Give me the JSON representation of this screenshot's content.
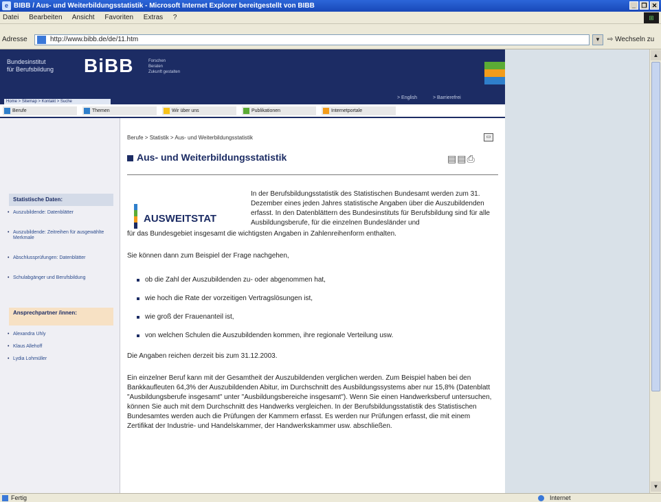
{
  "window": {
    "title": "BIBB / Aus- und Weiterbildungsstatistik - Microsoft Internet Explorer bereitgestellt von BIBB",
    "controls": [
      "_",
      "❐",
      "✕"
    ]
  },
  "menubar": {
    "items": [
      "Datei",
      "Bearbeiten",
      "Ansicht",
      "Favoriten",
      "Extras",
      "?"
    ]
  },
  "address": {
    "label": "Adresse",
    "url": "http://www.bibb.de/de/11.htm",
    "go_label": "Wechseln zu"
  },
  "header": {
    "institute": "Bundesinstitut\nfür Berufsbildung",
    "logo": "BiBB",
    "tagline": "Forschen\nBeraten\nZukunft gestalten",
    "lang_en": "> English",
    "lang_other": "> Barrierefrei",
    "breadcrumb_tab": "Home > Sitemap > Kontakt > Suche",
    "brand_colors": [
      "#5bab35",
      "#f39c1a",
      "#2f7fcb",
      "#1c2c64"
    ]
  },
  "nav": {
    "items": [
      {
        "label": "Berufe",
        "color": "#2f7fcb"
      },
      {
        "label": "Themen",
        "color": "#2f7fcb"
      },
      {
        "label": "Wir über uns",
        "color": "#f7c21a"
      },
      {
        "label": "Publikationen",
        "color": "#5bab35"
      },
      {
        "label": "Internetportale",
        "color": "#f39c1a"
      }
    ]
  },
  "sidebar": {
    "box1_title": "Statistische Daten:",
    "box1_items": [
      "Auszubildende: Datenblätter",
      "Auszubildende: Zeitreihen für ausgewählte Merkmale",
      "Abschlussprüfungen: Datenblätter",
      "Schulabgänger und Berufsbildung"
    ],
    "box2_title": "Ansprechpartner /innen:",
    "box2_items": [
      "Alexandra Uhly",
      "Klaus Allehoff",
      "Lydia Lohmüller"
    ]
  },
  "content": {
    "breadcrumb": "Berufe > Statistik > Aus- und Weiterbildungsstatistik",
    "title": "Aus- und Weiterbildungsstatistik",
    "tool_icons": [
      "print-icon",
      "mail-icon",
      "printer-icon"
    ],
    "logo_text": "AUSWEITSTAT",
    "logo_colors": [
      "#2f7fcb",
      "#5bab35",
      "#f39c1a",
      "#1c2c64"
    ],
    "intro_right": "In der Berufsbildungsstatistik des Statistischen Bundesamt werden zum 31. Dezember eines jeden Jahres statistische Angaben über die Auszubildenden erfasst. In den Datenblättern des Bundesinstituts für Berufsbildung sind für alle Ausbildungsberufe, für die einzelnen Bundesländer und",
    "intro_cont": "für das Bundesgebiet insgesamt die wichtigsten Angaben in Zahlenreihenform enthalten.",
    "question": "Sie können dann zum Beispiel der Frage nachgehen,",
    "bullets": [
      "ob die Zahl der Auszubildenden zu- oder abgenommen hat,",
      "wie hoch die Rate der vorzeitigen Vertragslösungen ist,",
      "wie groß der Frauenanteil ist,",
      "von welchen Schulen die Auszubildenden kommen, ihre regionale Verteilung usw."
    ],
    "data_range": "Die Angaben reichen derzeit bis zum 31.12.2003.",
    "paragraph": "Ein einzelner Beruf kann mit der Gesamtheit der Auszubildenden verglichen werden. Zum Beispiel haben bei den Bankkaufleuten 64,3% der Auszubildenden Abitur, im Durchschnitt des Ausbildungssystems aber nur 15,8% (Datenblatt \"Ausbildungsberufe insgesamt\" unter \"Ausbildungsbereiche insgesamt\"). Wenn Sie einen Handwerksberuf untersuchen, können Sie auch mit dem Durchschnitt des Handwerks vergleichen. In der Berufsbildungsstatistik des Statistischen Bundesamtes werden auch die Prüfungen der Kammern erfasst. Es werden nur Prüfungen erfasst, die mit einem Zertifikat der Industrie- und Handelskammer, der Handwerkskammer usw. abschließen."
  },
  "status": {
    "left": "Fertig",
    "zone": "Internet"
  }
}
